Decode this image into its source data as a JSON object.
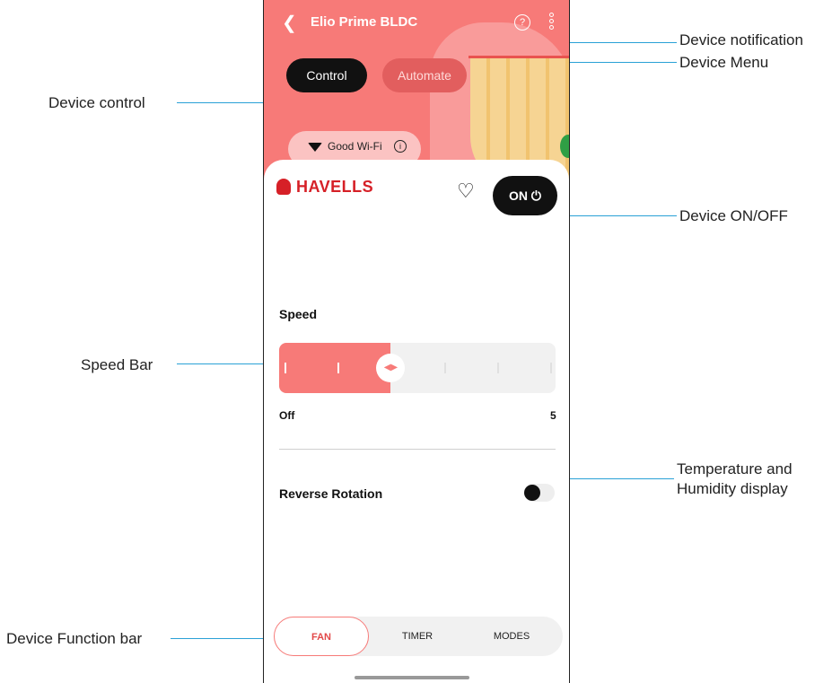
{
  "header": {
    "back_icon": "chevron-left-icon",
    "title": "Elio Prime BLDC",
    "help_icon": "help-circle-icon",
    "menu_icon": "more-vertical-icon"
  },
  "tabs": {
    "control": "Control",
    "automate": "Automate"
  },
  "wifi": {
    "label": "Good Wi-Fi",
    "icon": "wifi-icon",
    "info_icon": "info-icon"
  },
  "brand": "HAVELLS",
  "power": {
    "label": "ON",
    "icon": "power-icon"
  },
  "speed": {
    "label": "Speed",
    "min_label": "Off",
    "max_label": "5",
    "level": 2,
    "max": 5
  },
  "reverse": {
    "label": "Reverse Rotation",
    "enabled": false
  },
  "function_bar": {
    "fan": "FAN",
    "timer": "TIMER",
    "modes": "MODES"
  },
  "annotations": {
    "device_notification": "Device notification",
    "device_menu": "Device Menu",
    "device_control": "Device control",
    "device_onoff": "Device ON/OFF",
    "speed_bar": "Speed Bar",
    "temp_humidity_1": "Temperature and",
    "temp_humidity_2": "Humidity display",
    "function_bar": "Device Function bar"
  },
  "colors": {
    "accent": "#f77a78",
    "brand": "#d62027",
    "annotation": "#2aa1d6"
  }
}
